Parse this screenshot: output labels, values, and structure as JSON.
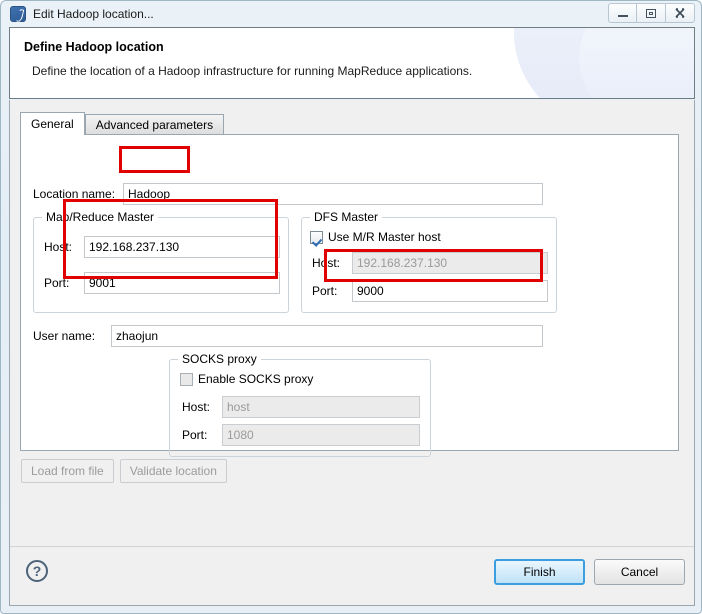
{
  "window": {
    "title": "Edit Hadoop location...",
    "icon": "hadoop-plugin-icon",
    "controls": {
      "minimize": "minimize-icon",
      "maximize": "maximize-icon",
      "close": "close-icon"
    }
  },
  "header": {
    "title": "Define Hadoop location",
    "description": "Define the location of a Hadoop infrastructure for running MapReduce applications."
  },
  "tabs": [
    {
      "label": "General",
      "selected": true
    },
    {
      "label": "Advanced parameters",
      "selected": false
    }
  ],
  "form": {
    "location_name": {
      "label": "Location name:",
      "value": "Hadoop"
    },
    "mr_master": {
      "title": "Map/Reduce Master",
      "host_label": "Host:",
      "host_value": "192.168.237.130",
      "port_label": "Port:",
      "port_value": "9001"
    },
    "dfs_master": {
      "title": "DFS Master",
      "use_mr_host_label": "Use M/R Master host",
      "use_mr_host_checked": true,
      "host_label": "Host:",
      "host_value": "192.168.237.130",
      "port_label": "Port:",
      "port_value": "9000"
    },
    "user_name": {
      "label": "User name:",
      "value": "zhaojun"
    },
    "socks_proxy": {
      "title": "SOCKS proxy",
      "enable_label": "Enable SOCKS proxy",
      "enable_checked": false,
      "host_label": "Host:",
      "host_value": "host",
      "port_label": "Port:",
      "port_value": "1080"
    }
  },
  "actions": {
    "load_from_file": "Load from file",
    "validate_location": "Validate location"
  },
  "footer": {
    "help": "?",
    "finish": "Finish",
    "cancel": "Cancel"
  },
  "annotations": {
    "color": "#e00000",
    "boxes": [
      "location-name-value",
      "mr-master-fields",
      "dfs-master-port"
    ]
  }
}
